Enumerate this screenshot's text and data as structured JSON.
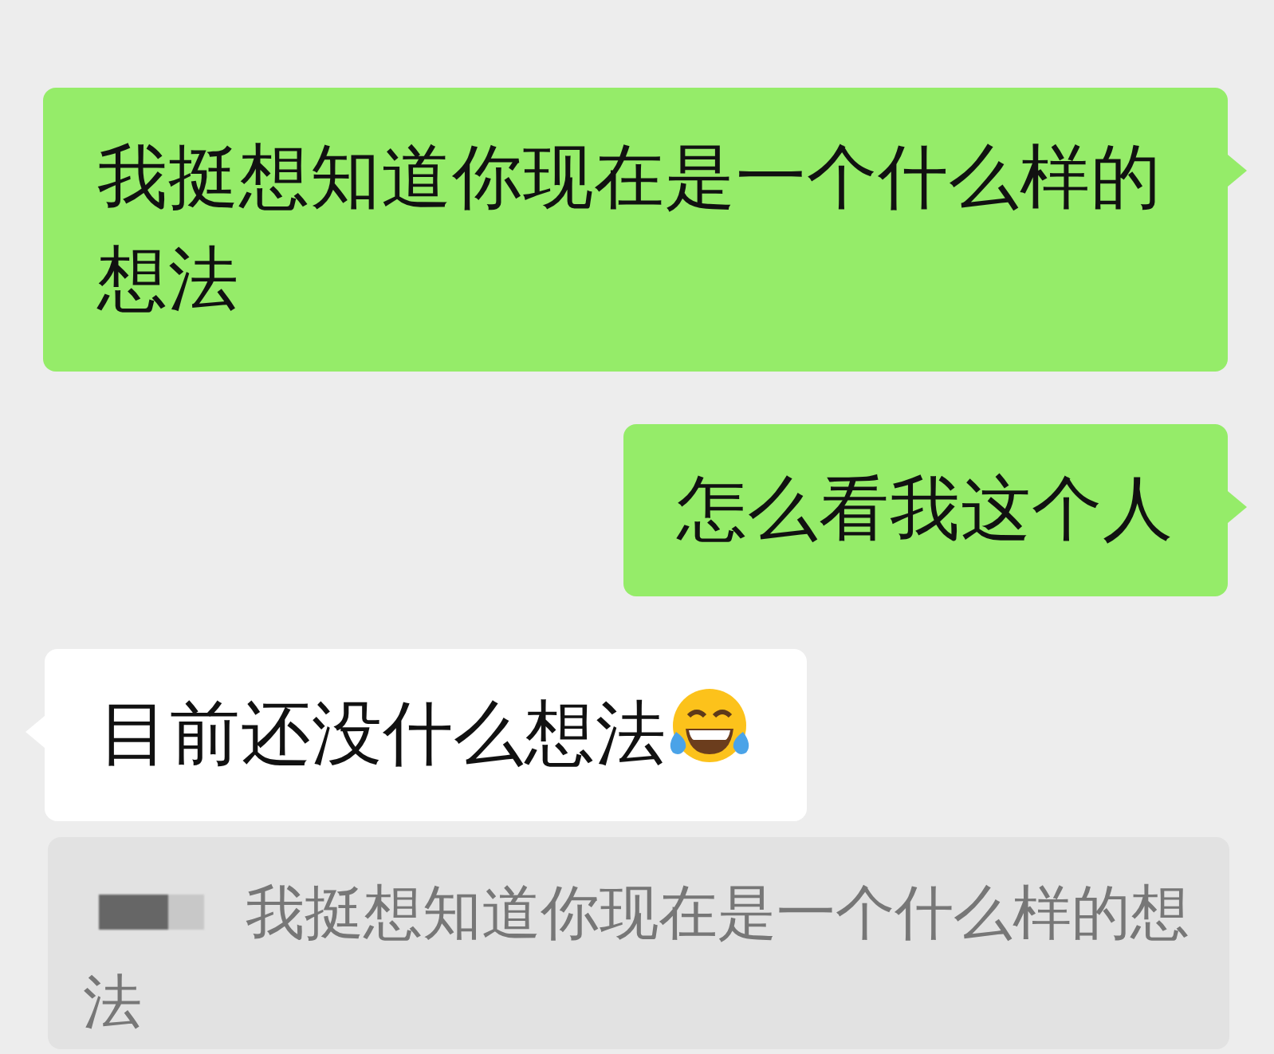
{
  "messages": [
    {
      "kind": "outgoing",
      "text": "我挺想知道你现在是一个什么样的想法",
      "has_emoji": false
    },
    {
      "kind": "outgoing",
      "text": "怎么看我这个人",
      "has_emoji": false
    },
    {
      "kind": "incoming",
      "text": "目前还没什么想法",
      "has_emoji": true
    }
  ],
  "quote": {
    "sender_redacted": true,
    "text": "我挺想知道你现在是一个什么样的想法"
  }
}
